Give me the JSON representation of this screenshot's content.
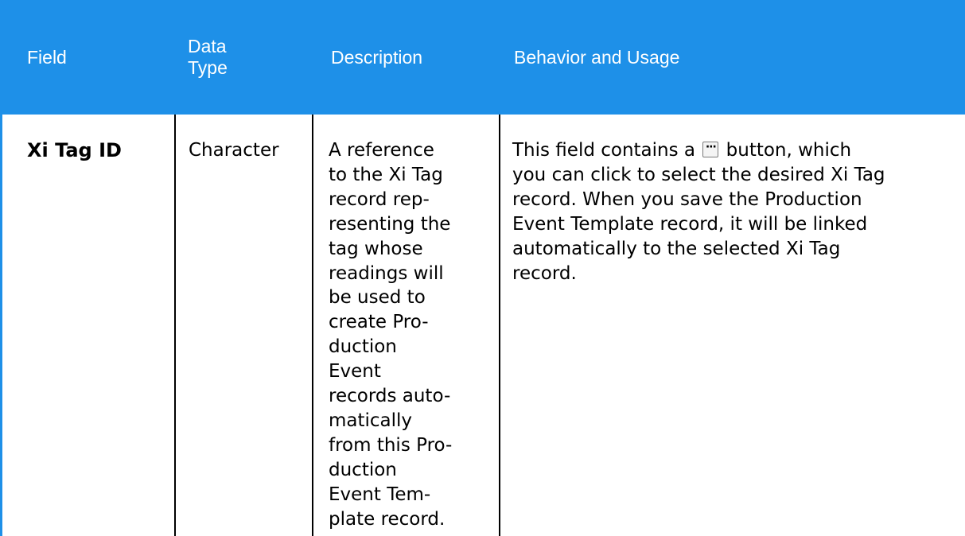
{
  "header": {
    "field": "Field",
    "data_type_line1": "Data",
    "data_type_line2": "Type",
    "description": "Description",
    "behavior": "Behavior and Usage"
  },
  "row": {
    "field": "Xi Tag ID",
    "data_type": "Character",
    "description_lines": [
      "A reference",
      "to the Xi Tag",
      "record rep-",
      "resenting the",
      "tag whose",
      "readings will",
      "be used to",
      "create Pro-",
      "duction",
      "Event",
      "records auto-",
      "matically",
      "from this Pro-",
      "duction",
      "Event Tem-",
      "plate record."
    ],
    "behavior_before_icon": "This field contains a",
    "behavior_icon": "ellipsis-button-icon",
    "behavior_icon_glyph": "···",
    "behavior_after_icon": "button, which",
    "behavior_lines": [
      "you can click to select the desired Xi Tag",
      "record. When you save the Production",
      "Event Template record, it will be linked",
      "automatically to the selected Xi Tag",
      "record."
    ]
  },
  "colors": {
    "header_bg": "#1e90e8",
    "header_text": "#ffffff",
    "grid_line": "#000000"
  }
}
